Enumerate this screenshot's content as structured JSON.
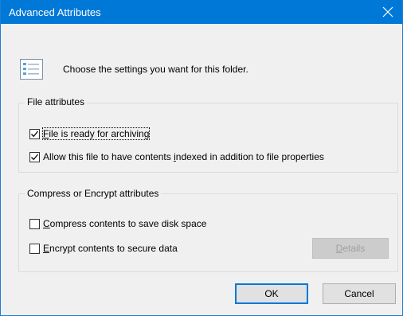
{
  "window": {
    "title": "Advanced Attributes",
    "header_text": "Choose the settings you want for this folder."
  },
  "file_attributes": {
    "legend": "File attributes",
    "items": [
      {
        "pre": "",
        "key": "F",
        "post": "ile is ready for archiving",
        "checked": true
      },
      {
        "pre": "Allow this file to have contents ",
        "key": "i",
        "post": "ndexed in addition to file properties",
        "checked": true
      }
    ]
  },
  "compress_encrypt": {
    "legend": "Compress or Encrypt attributes",
    "items": [
      {
        "pre": "",
        "key": "C",
        "post": "ompress contents to save disk space",
        "checked": false
      },
      {
        "pre": "",
        "key": "E",
        "post": "ncrypt contents to secure data",
        "checked": false
      }
    ],
    "details_pre": "",
    "details_key": "D",
    "details_post": "etails"
  },
  "buttons": {
    "ok": "OK",
    "cancel": "Cancel"
  },
  "colors": {
    "titlebar": "#0078d7",
    "dialog_bg": "#f0f0f0",
    "check": "#000000"
  }
}
